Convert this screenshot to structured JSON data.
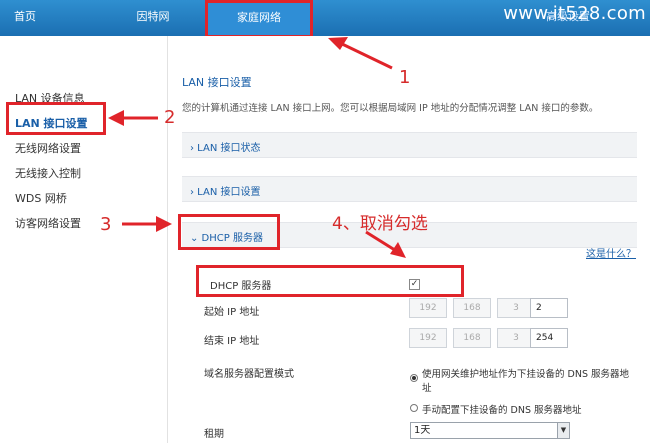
{
  "nav": {
    "home": "首页",
    "internet": "因特网",
    "home_network": "家庭网络",
    "right": "高级设置"
  },
  "watermark": "www.it528.com",
  "sidebar": {
    "items": [
      {
        "label": "LAN 设备信息"
      },
      {
        "label": "LAN 接口设置"
      },
      {
        "label": "无线网络设置"
      },
      {
        "label": "无线接入控制"
      },
      {
        "label": "WDS 网桥"
      },
      {
        "label": "访客网络设置"
      }
    ]
  },
  "main": {
    "title": "LAN 接口设置",
    "description": "您的计算机通过连接 LAN 接口上网。您可以根据局域网 IP 地址的分配情况调整 LAN 接口的参数。",
    "sections": [
      {
        "label": "› LAN 接口状态"
      },
      {
        "label": "› LAN 接口设置"
      },
      {
        "label": "⌄ DHCP 服务器"
      }
    ],
    "help_link": "这是什么？",
    "dhcp": {
      "server_label": "DHCP 服务器",
      "checkbox_mark": "✓",
      "start_ip_label": "起始 IP 地址",
      "start_ip": [
        "192",
        "168",
        "3",
        "2"
      ],
      "end_ip_label": "结束 IP 地址",
      "end_ip": [
        "192",
        "168",
        "3",
        "254"
      ],
      "dns_mode_label": "域名服务器配置模式",
      "dns_option_1_line1": "使用网关维护地址作为下挂设备的 DNS 服务器地",
      "dns_option_1_line2": "址",
      "dns_option_2": "手动配置下挂设备的 DNS 服务器地址",
      "lease_label": "租期",
      "lease_value": "1天"
    }
  },
  "annotations": {
    "n1": "1",
    "n2": "2",
    "n3": "3",
    "n4": "4、取消勾选"
  },
  "colors": {
    "nav_blue": "#1b6fb2",
    "annotation_red": "#e0242a",
    "link_blue": "#1a5fa8"
  }
}
